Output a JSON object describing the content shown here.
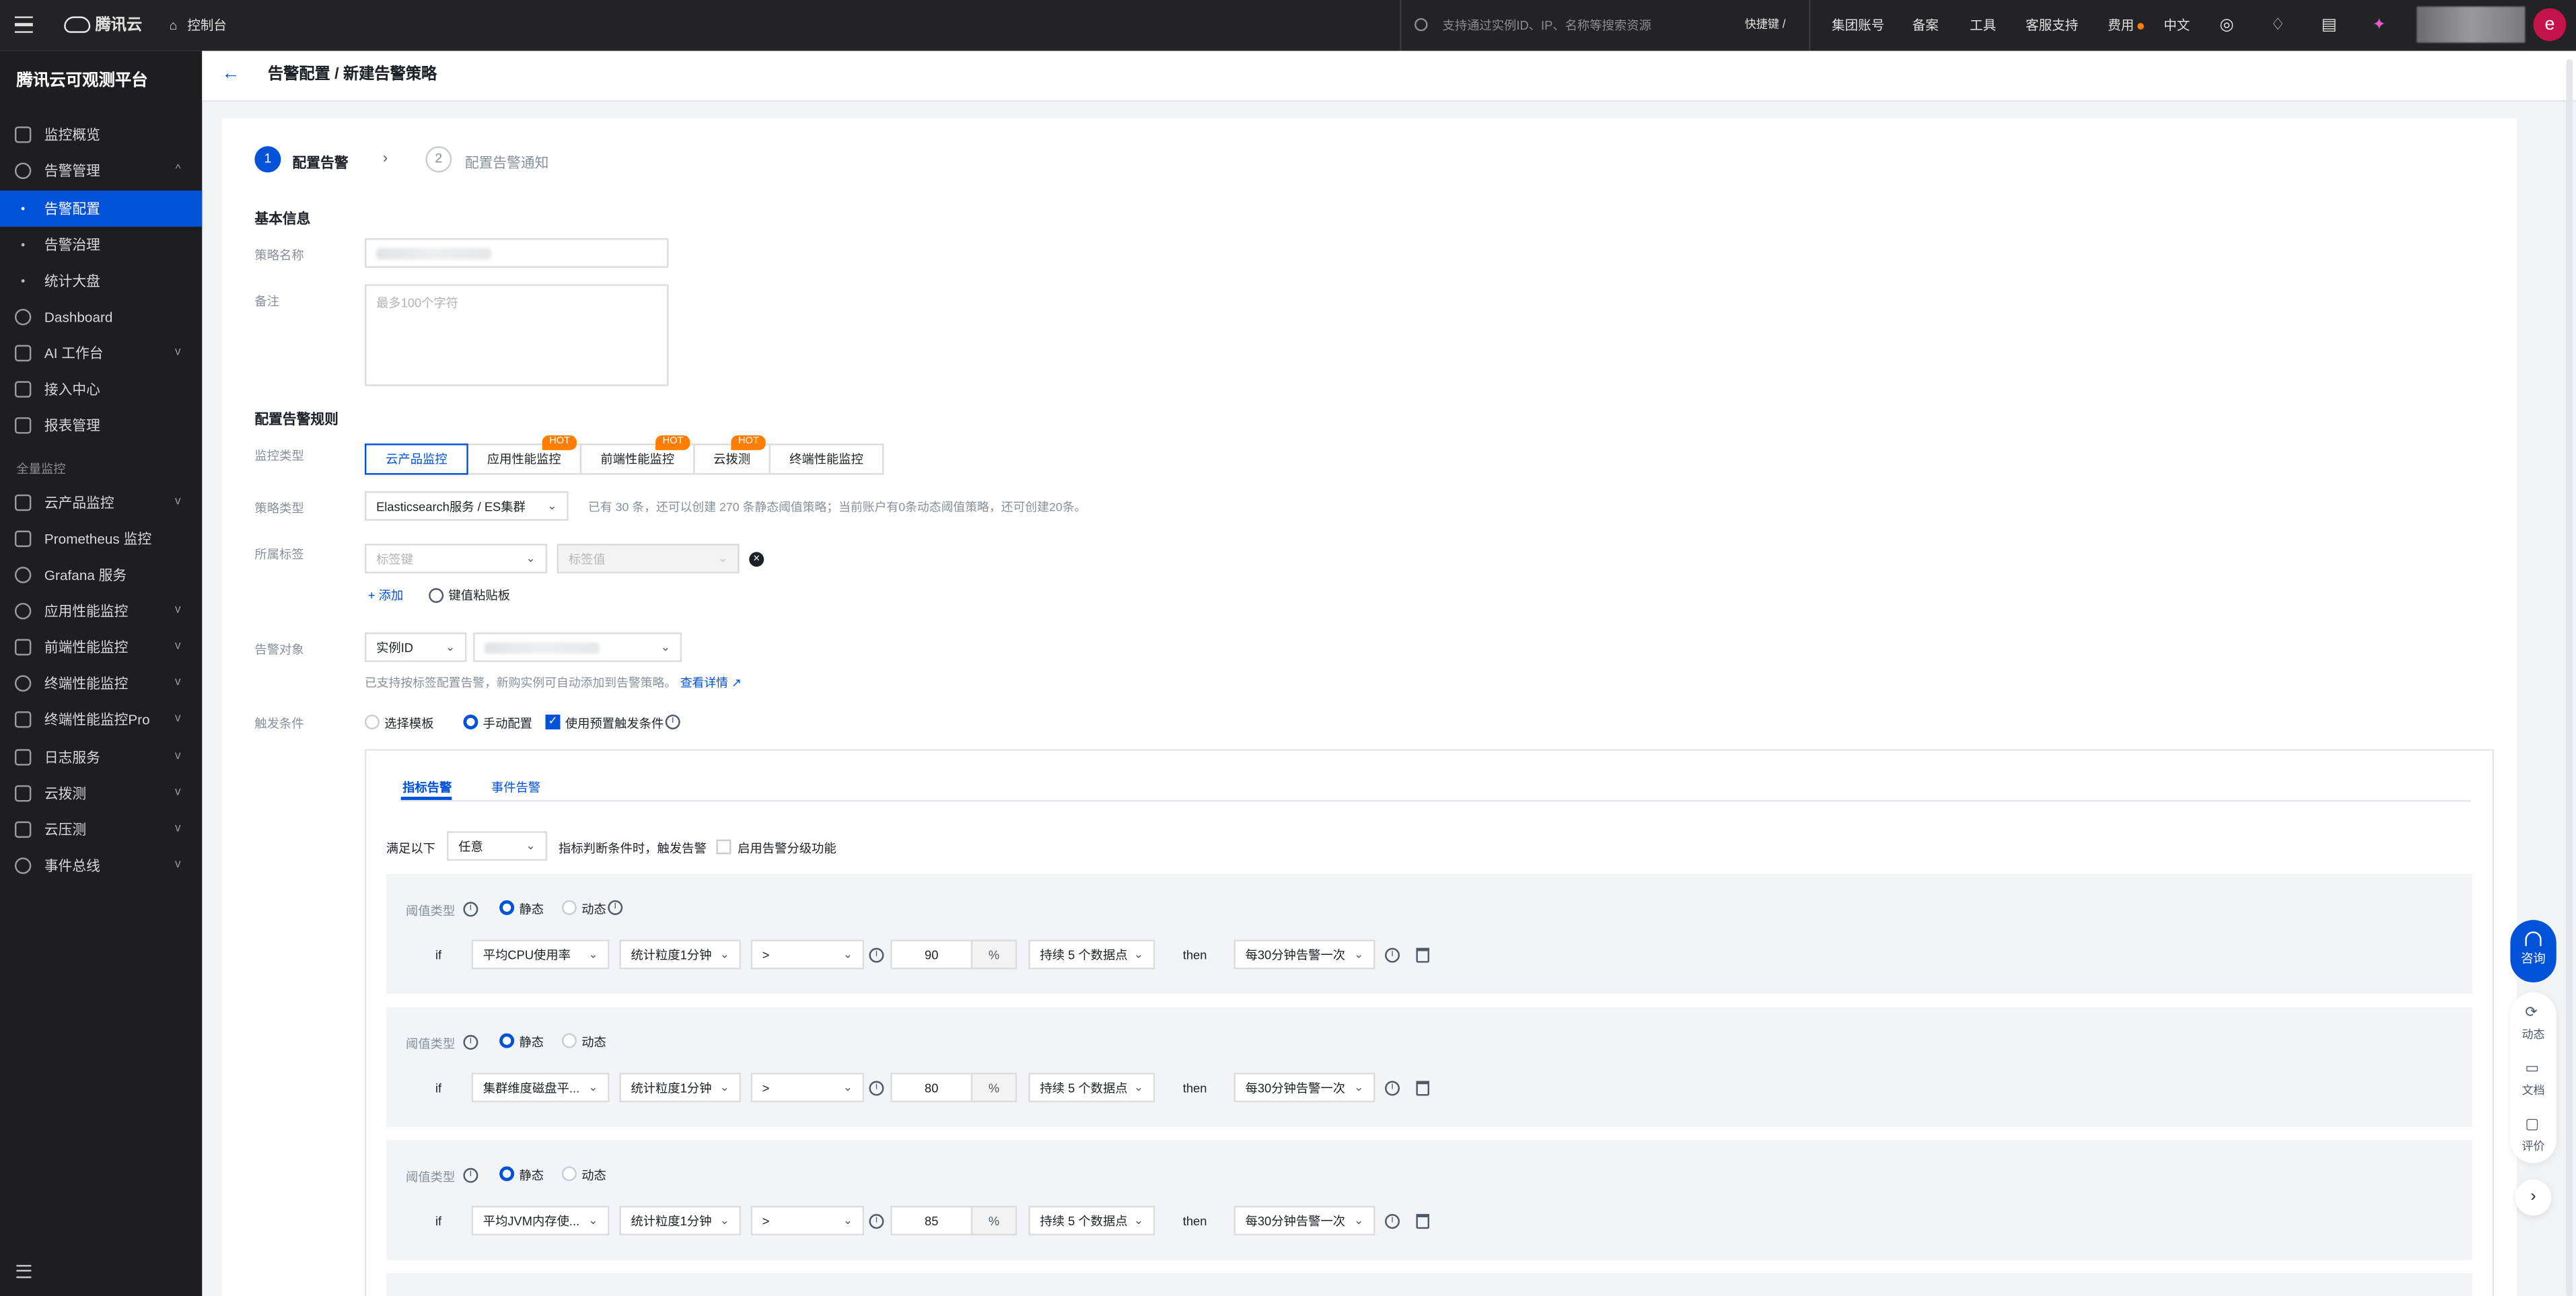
{
  "topbar": {
    "brand": "腾讯云",
    "console": "控制台",
    "search_placeholder": "支持通过实例ID、IP、名称等搜索资源",
    "shortcut": "快捷键 /",
    "menu": [
      "集团账号",
      "备案",
      "工具",
      "客服支持",
      "费用",
      "中文"
    ],
    "avatar_letter": "e"
  },
  "sidebar": {
    "title": "腾讯云可观测平台",
    "items": [
      {
        "label": "监控概览",
        "chevron": ""
      },
      {
        "label": "告警管理",
        "chevron": "^"
      },
      {
        "label": "告警配置",
        "chevron": ""
      },
      {
        "label": "告警治理",
        "chevron": ""
      },
      {
        "label": "统计大盘",
        "chevron": ""
      },
      {
        "label": "Dashboard",
        "chevron": ""
      },
      {
        "label": "AI 工作台",
        "chevron": "v"
      },
      {
        "label": "接入中心",
        "chevron": ""
      },
      {
        "label": "报表管理",
        "chevron": ""
      }
    ],
    "section": "全量监控",
    "items2": [
      {
        "label": "云产品监控",
        "chevron": "v"
      },
      {
        "label": "Prometheus 监控",
        "chevron": ""
      },
      {
        "label": "Grafana 服务",
        "chevron": ""
      },
      {
        "label": "应用性能监控",
        "chevron": "v"
      },
      {
        "label": "前端性能监控",
        "chevron": "v"
      },
      {
        "label": "终端性能监控",
        "chevron": "v"
      },
      {
        "label": "终端性能监控Pro",
        "chevron": "v"
      },
      {
        "label": "日志服务",
        "chevron": "v"
      },
      {
        "label": "云拨测",
        "chevron": "v"
      },
      {
        "label": "云压测",
        "chevron": "v"
      },
      {
        "label": "事件总线",
        "chevron": "v"
      }
    ]
  },
  "header": {
    "title": "告警配置 / 新建告警策略"
  },
  "steps": [
    {
      "num": "1",
      "label": "配置告警"
    },
    {
      "num": "2",
      "label": "配置告警通知"
    }
  ],
  "basic": {
    "section": "基本信息",
    "name_label": "策略名称",
    "remark_label": "备注",
    "remark_placeholder": "最多100个字符"
  },
  "rules": {
    "section": "配置告警规则",
    "monitor_type_label": "监控类型",
    "monitor_types": [
      {
        "label": "云产品监控",
        "hot": ""
      },
      {
        "label": "应用性能监控",
        "hot": "HOT"
      },
      {
        "label": "前端性能监控",
        "hot": "HOT"
      },
      {
        "label": "云拨测",
        "hot": "HOT"
      },
      {
        "label": "终端性能监控",
        "hot": ""
      }
    ],
    "policy_type_label": "策略类型",
    "policy_type_value": "Elasticsearch服务 / ES集群",
    "policy_type_hint": "已有 30 条，还可以创建 270 条静态阈值策略；当前账户有0条动态阈值策略，还可创建20条。",
    "tag_label": "所属标签",
    "tag_key_placeholder": "标签键",
    "tag_value_placeholder": "标签值",
    "add_label": "添加",
    "paste_label": "键值粘贴板",
    "target_label": "告警对象",
    "target_type": "实例ID",
    "target_hint": "已支持按标签配置告警，新购实例可自动添加到告警策略。",
    "target_link": "查看详情",
    "trigger_label": "触发条件",
    "trigger_template": "选择模板",
    "trigger_manual": "手动配置",
    "trigger_preset": "使用预置触发条件"
  },
  "panel": {
    "tabs": [
      "指标告警",
      "事件告警"
    ],
    "satisfy_label": "满足以下",
    "satisfy_value": "任意",
    "satisfy_suffix": "指标判断条件时，触发告警",
    "grade_label": "启用告警分级功能",
    "rules": [
      {
        "threshold_label": "阈值类型",
        "static": "静态",
        "dynamic": "动态",
        "if": "if",
        "metric": "平均CPU使用率",
        "granularity": "统计粒度1分钟",
        "op": ">",
        "value": "90",
        "unit": "%",
        "duration": "持续 5 个数据点",
        "then": "then",
        "alarm": "每30分钟告警一次"
      },
      {
        "threshold_label": "阈值类型",
        "static": "静态",
        "dynamic": "动态",
        "if": "if",
        "metric": "集群维度磁盘平...",
        "granularity": "统计粒度1分钟",
        "op": ">",
        "value": "80",
        "unit": "%",
        "duration": "持续 5 个数据点",
        "then": "then",
        "alarm": "每30分钟告警一次"
      },
      {
        "threshold_label": "阈值类型",
        "static": "静态",
        "dynamic": "动态",
        "if": "if",
        "metric": "平均JVM内存使...",
        "granularity": "统计粒度1分钟",
        "op": ">",
        "value": "85",
        "unit": "%",
        "duration": "持续 5 个数据点",
        "then": "then",
        "alarm": "每30分钟告警一次"
      }
    ]
  },
  "float": {
    "consult": "咨询",
    "items": [
      "动态",
      "文档",
      "评价"
    ]
  },
  "colors": {
    "primary": "#0052d9",
    "hot": "#ff7d00",
    "avatar": "#c4124b",
    "sidebar_bg": "#1e1e20",
    "topbar_bg": "#232326"
  }
}
